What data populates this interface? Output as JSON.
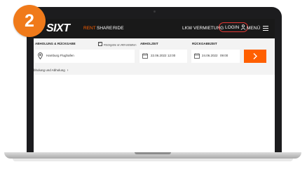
{
  "step_badge": "2",
  "nav": {
    "logo": "SIXT",
    "links": [
      "RENT",
      "SHARE",
      "RIDE"
    ],
    "truck_rental": "LKW VERMIETUNG",
    "login": "LOGIN",
    "menu": "MENÜ"
  },
  "booking": {
    "pickup_return_label": "ABHOLUNG & RÜCKGABE",
    "return_at_pickup_checkbox": "Rückgabe an Abholstation",
    "pickup_time_label": "ABHOLZEIT",
    "return_time_label": "RÜCKGABEZEIT",
    "location_value": "Hamburg Flughafen",
    "pickup_date": "22.06.2022",
    "pickup_time": "12:00",
    "return_date": "24.06.2022",
    "return_time": "09:00",
    "other_return_link": "bholung und Abholung"
  },
  "colors": {
    "accent": "#ff5f00",
    "nav_bg": "#191919",
    "badge": "#f07a1a",
    "login_highlight": "#e53935"
  }
}
